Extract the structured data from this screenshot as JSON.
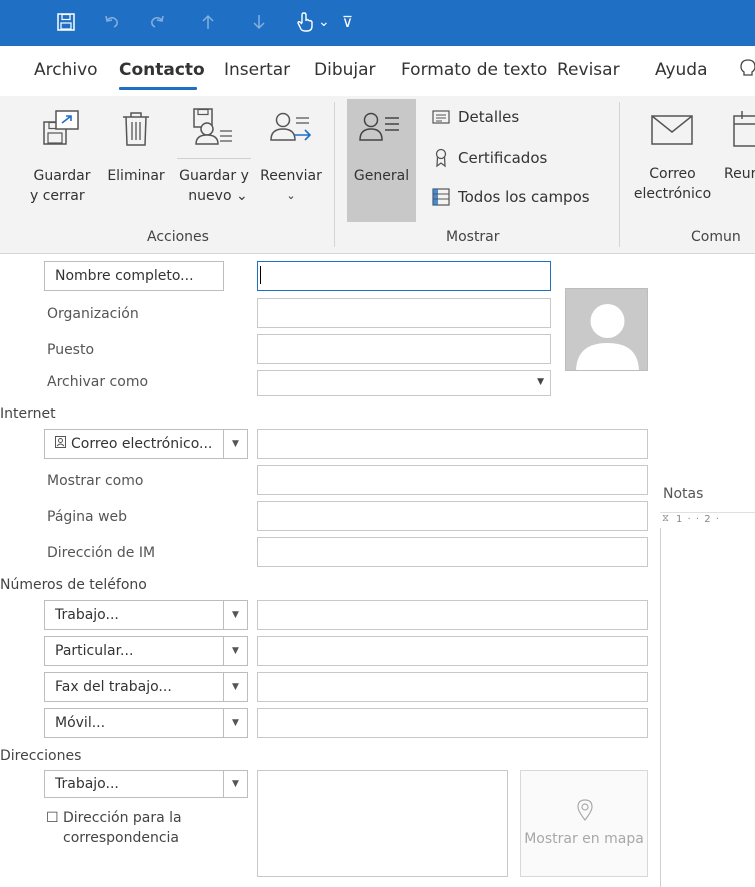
{
  "quick_access": {
    "icons": [
      "save-icon",
      "undo-icon",
      "redo-icon",
      "up-arrow-icon",
      "down-arrow-icon",
      "touch-mode-icon",
      "customize-icon"
    ],
    "chevron": "⌄",
    "more": "⊽"
  },
  "tabs": [
    {
      "label": "Archivo"
    },
    {
      "label": "Contacto"
    },
    {
      "label": "Insertar"
    },
    {
      "label": "Dibujar"
    },
    {
      "label": "Formato de texto"
    },
    {
      "label": "Revisar"
    },
    {
      "label": "Ayuda"
    }
  ],
  "ribbon": {
    "acciones": {
      "group_label": "Acciones",
      "guardar_cerrar": [
        "Guardar",
        "y cerrar"
      ],
      "eliminar": "Eliminar",
      "guardar_nuevo": [
        "Guardar y",
        "nuevo ⌄"
      ],
      "reenviar": [
        "Reenviar",
        "⌄"
      ]
    },
    "mostrar": {
      "group_label": "Mostrar",
      "general": "General",
      "detalles": "Detalles",
      "certificados": "Certificados",
      "todos": "Todos los campos"
    },
    "comunicar": {
      "group_label": "Comun",
      "correo": [
        "Correo",
        "electrónico"
      ],
      "reunion": "Reur"
    }
  },
  "form": {
    "nombre_btn": "Nombre completo...",
    "organizacion": "Organización",
    "puesto": "Puesto",
    "archivar": "Archivar como",
    "internet": "Internet",
    "correo_btn": "Correo electrónico...",
    "mostrar_como": "Mostrar como",
    "pagina_web": "Página web",
    "direccion_im": "Dirección de IM",
    "telefonos": "Números de teléfono",
    "phones": [
      "Trabajo...",
      "Particular...",
      "Fax del trabajo...",
      "Móvil..."
    ],
    "direcciones": "Direcciones",
    "dir_btn": "Trabajo...",
    "correspondencia_check": "☐",
    "correspondencia": [
      "Dirección para la",
      "correspondencia"
    ],
    "mapa": "Mostrar en mapa",
    "notas": "Notas",
    "ruler": "1 · · 2 ·"
  },
  "colors": {
    "accent": "#1f6fc5",
    "ribbon_bg": "#f3f3f3",
    "selected_btn": "#c8c8c8"
  }
}
